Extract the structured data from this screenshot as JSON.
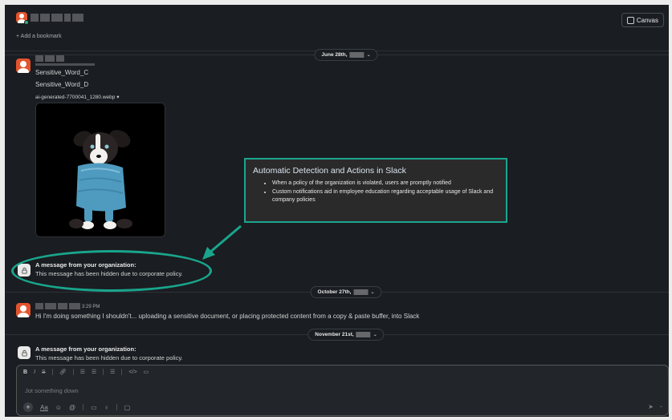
{
  "header": {
    "bookmark_label": "+ Add a bookmark",
    "canvas_label": "Canvas"
  },
  "date_separators": {
    "first": "June 28th,",
    "second": "October 27th,",
    "third": "November 21st,"
  },
  "message1": {
    "line1": "Sensitive_Word_C",
    "line2": "Sensitive_Word_D",
    "file_name": "ai-generated-7700041_1280.webp",
    "file_chevron": "▾"
  },
  "org_message_1": {
    "title": "A message from your organization:",
    "body": "This message has been hidden due to corporate policy."
  },
  "callout": {
    "title": "Automatic Detection and Actions in Slack",
    "bullets": [
      "When a policy of the organization is violated, users are promptly notified",
      "Custom notifications aid in employee education regarding acceptable usage of Slack and company policies"
    ],
    "border_color": "#1aa68f"
  },
  "message2": {
    "time": "3:29 PM",
    "text": "Hi I'm doing something I shouldn't... uploading a sensitive document, or placing protected content from a copy & paste buffer, into Slack"
  },
  "org_message_2": {
    "title": "A message from your organization:",
    "body": "This message has been hidden due to corporate policy."
  },
  "composer": {
    "placeholder": "Jot something down",
    "aa_label": "Aa"
  },
  "colors": {
    "background": "#1a1d21",
    "accent_teal": "#19a58d",
    "avatar_orange": "#e2542c"
  }
}
